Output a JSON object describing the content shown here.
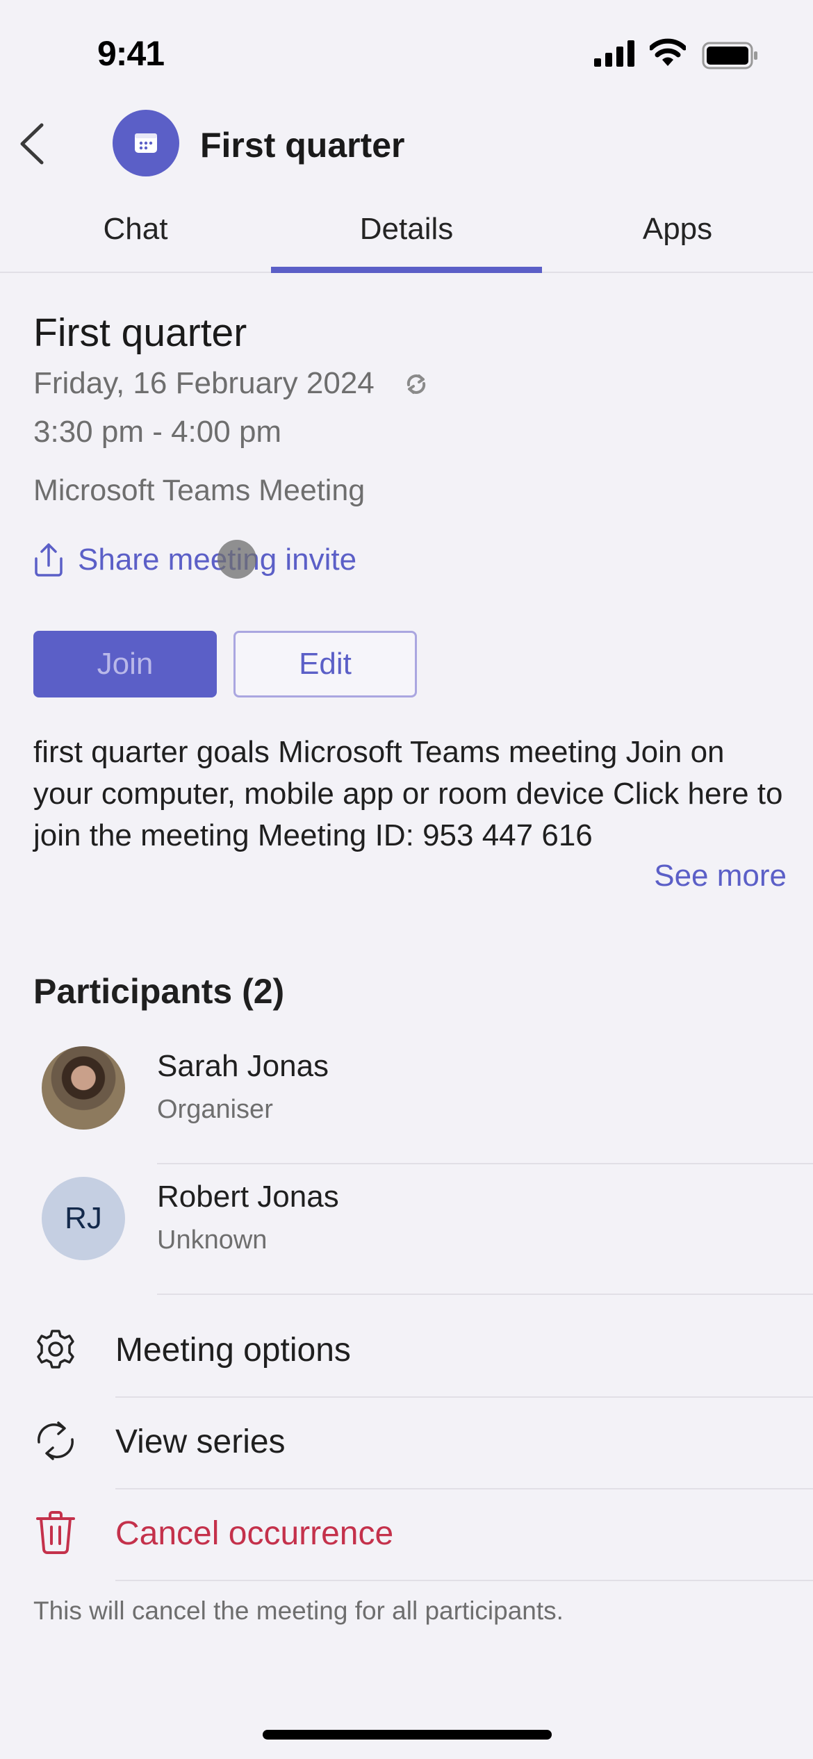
{
  "status_bar": {
    "time": "9:41"
  },
  "header": {
    "title": "First quarter",
    "avatar_icon": "calendar-icon"
  },
  "tabs": [
    {
      "label": "Chat",
      "active": false
    },
    {
      "label": "Details",
      "active": true
    },
    {
      "label": "Apps",
      "active": false
    }
  ],
  "meeting": {
    "title": "First quarter",
    "date": "Friday, 16 February 2024",
    "time": "3:30 pm - 4:00 pm",
    "type": "Microsoft Teams Meeting",
    "share_label": "Share meeting invite",
    "join_label": "Join",
    "edit_label": "Edit",
    "description": "first quarter goals Microsoft Teams meeting Join on your computer, mobile app or room device Click here to join the meeting Meeting ID: 953 447 616",
    "see_more_label": "See more"
  },
  "participants": {
    "heading": "Participants (2)",
    "items": [
      {
        "name": "Sarah Jonas",
        "role": "Organiser",
        "avatar": "photo"
      },
      {
        "name": "Robert Jonas",
        "role": "Unknown",
        "initials": "RJ"
      }
    ]
  },
  "actions": [
    {
      "label": "Meeting options",
      "icon": "gear-icon"
    },
    {
      "label": "View series",
      "icon": "recurrence-icon"
    },
    {
      "label": "Cancel occurrence",
      "icon": "trash-icon",
      "danger": true
    }
  ],
  "footnote": "This will cancel the meeting for all participants.",
  "colors": {
    "accent": "#5b5fc7",
    "danger": "#c4314b",
    "background": "#f3f2f7"
  }
}
